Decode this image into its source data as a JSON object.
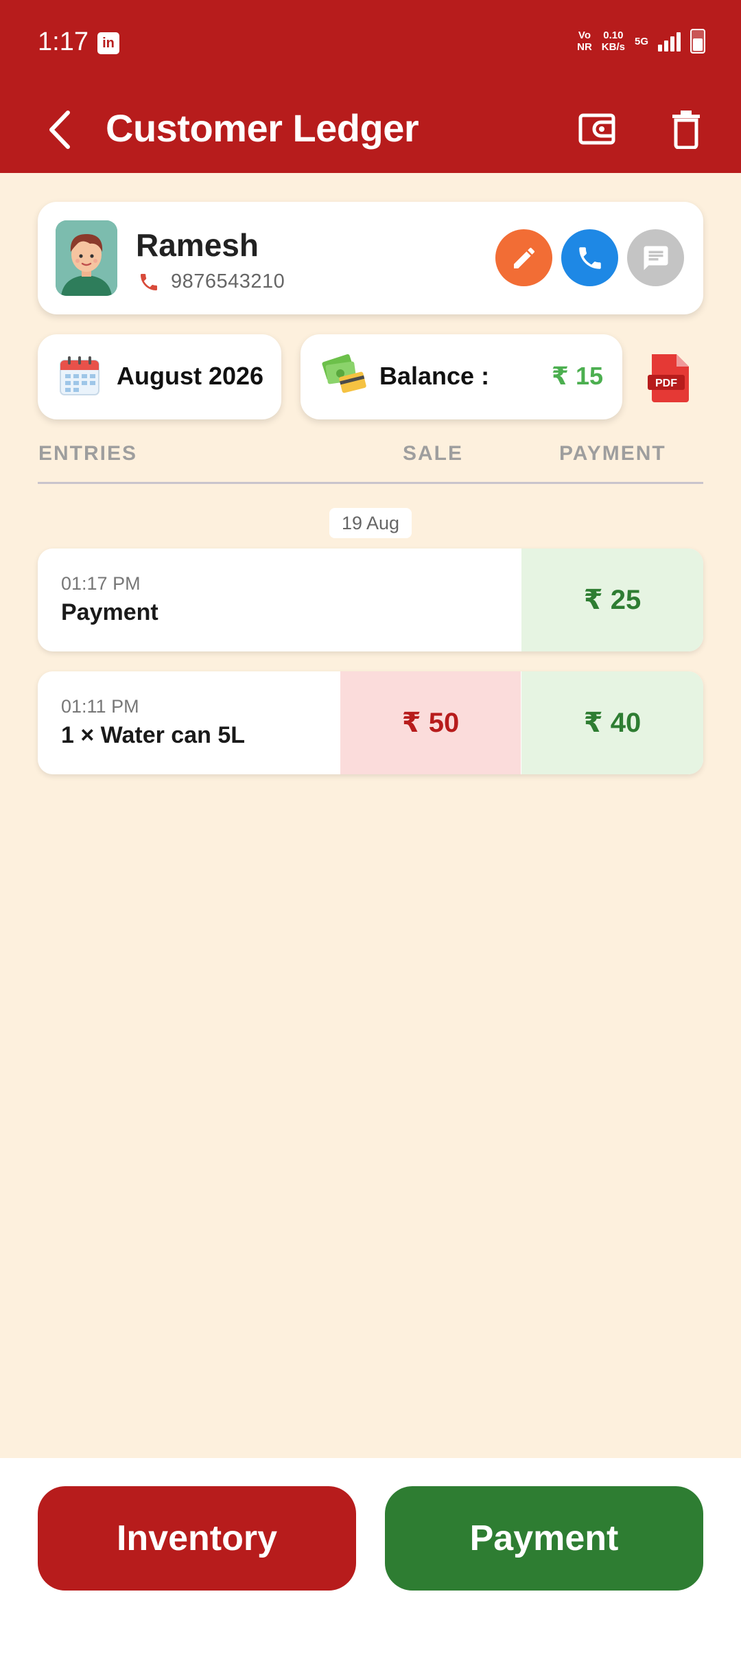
{
  "status_bar": {
    "time": "1:17",
    "app_icon": "in",
    "net_type": "Vo",
    "net_sub": "NR",
    "speed_value": "0.10",
    "speed_unit": "KB/s",
    "network": "5G",
    "battery_level": 0.55
  },
  "app_bar": {
    "title": "Customer Ledger"
  },
  "customer": {
    "name": "Ramesh",
    "phone": "9876543210"
  },
  "summary": {
    "month": "August 2026",
    "balance_label": "Balance :",
    "balance_value": "₹ 15",
    "pdf_label": "PDF"
  },
  "columns": {
    "entries": "ENTRIES",
    "sale": "SALE",
    "payment": "PAYMENT"
  },
  "date_group": "19 Aug",
  "entries": [
    {
      "time": "01:17 PM",
      "description": "Payment",
      "sale": "",
      "payment": "₹ 25"
    },
    {
      "time": "01:11 PM",
      "description": "1 × Water can 5L",
      "sale": "₹ 50",
      "payment": "₹ 40"
    }
  ],
  "actions": {
    "inventory": "Inventory",
    "payment": "Payment"
  },
  "colors": {
    "primary": "#b71c1c",
    "success": "#2e7d32",
    "background": "#fdf0dd",
    "edit": "#f26d35",
    "call": "#1e88e5"
  }
}
